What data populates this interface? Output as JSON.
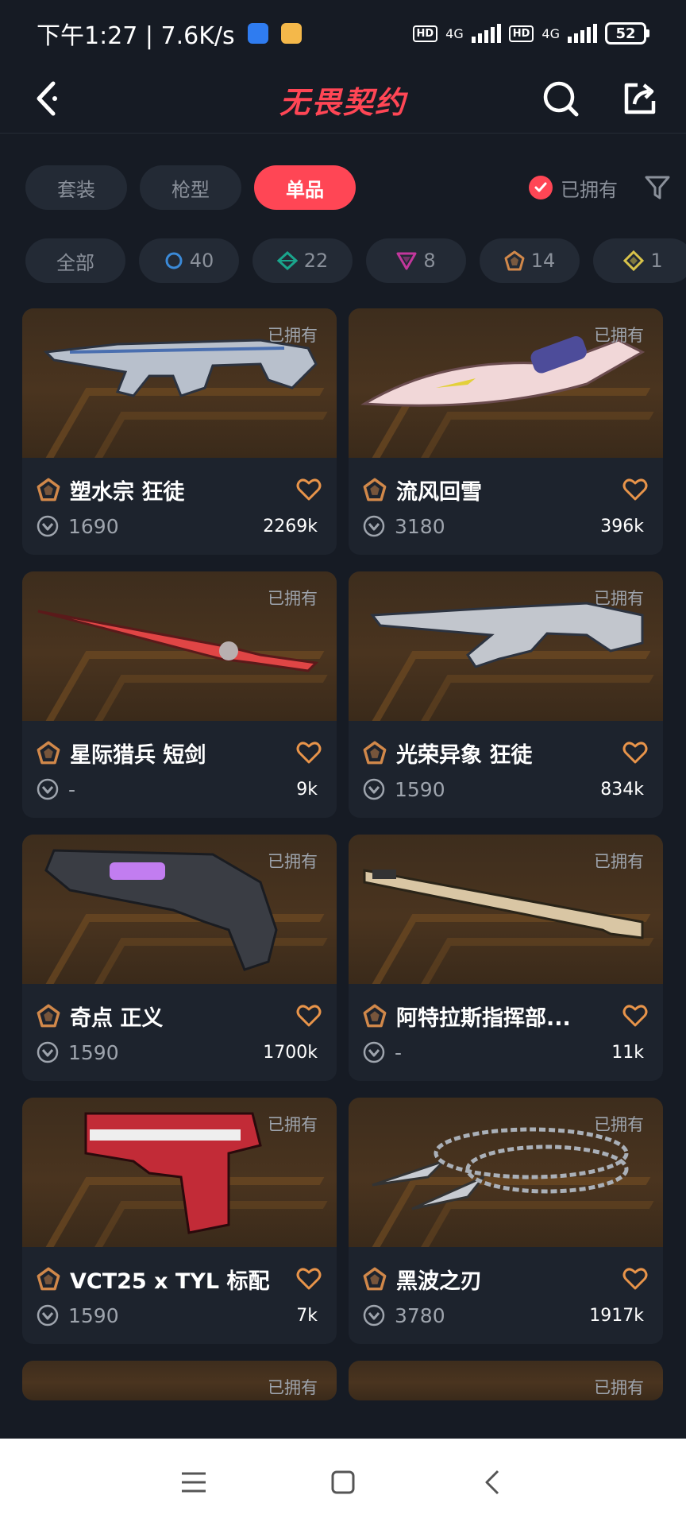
{
  "status_bar": {
    "time_speed": "下午1:27 | 7.6K/s",
    "hd1": "HD",
    "net1": "4G",
    "hd2": "HD",
    "net2": "4G",
    "battery": "52"
  },
  "header": {
    "title": "无畏契约"
  },
  "tabs": [
    "套装",
    "枪型",
    "单品"
  ],
  "active_tab": "单品",
  "owned_filter_label": "已拥有",
  "rarity_filters": [
    {
      "label": "全部",
      "icon": null
    },
    {
      "label": "40",
      "icon": "select-tier-icon",
      "color": "#3b8ad8"
    },
    {
      "label": "22",
      "icon": "deluxe-tier-icon",
      "color": "#1aa58c"
    },
    {
      "label": "8",
      "icon": "premium-tier-icon",
      "color": "#c2379c"
    },
    {
      "label": "14",
      "icon": "exclusive-tier-icon",
      "color": "#d1884a"
    },
    {
      "label": "1",
      "icon": "ultra-tier-icon",
      "color": "#d8c34a"
    }
  ],
  "cards": [
    {
      "owned": "已拥有",
      "name": "塑水宗 狂徒",
      "price": "1690",
      "likes": "2269k"
    },
    {
      "owned": "已拥有",
      "name": "流风回雪",
      "price": "3180",
      "likes": "396k"
    },
    {
      "owned": "已拥有",
      "name": "星际猎兵 短剑",
      "price": "-",
      "likes": "9k"
    },
    {
      "owned": "已拥有",
      "name": "光荣异象 狂徒",
      "price": "1590",
      "likes": "834k"
    },
    {
      "owned": "已拥有",
      "name": "奇点 正义",
      "price": "1590",
      "likes": "1700k"
    },
    {
      "owned": "已拥有",
      "name": "阿特拉斯指挥部...",
      "price": "-",
      "likes": "11k"
    },
    {
      "owned": "已拥有",
      "name": "VCT25 x TYL 标配",
      "price": "1590",
      "likes": "7k"
    },
    {
      "owned": "已拥有",
      "name": "黑波之刃",
      "price": "3780",
      "likes": "1917k"
    },
    {
      "owned": "已拥有",
      "name": "",
      "price": "",
      "likes": ""
    },
    {
      "owned": "已拥有",
      "name": "",
      "price": "",
      "likes": ""
    }
  ],
  "colors": {
    "accent": "#ff4655",
    "background": "#161b24",
    "card": "#1d232d",
    "chip": "#232a35",
    "tier_exclusive": "#d1884a",
    "heart": "#e8944a"
  }
}
